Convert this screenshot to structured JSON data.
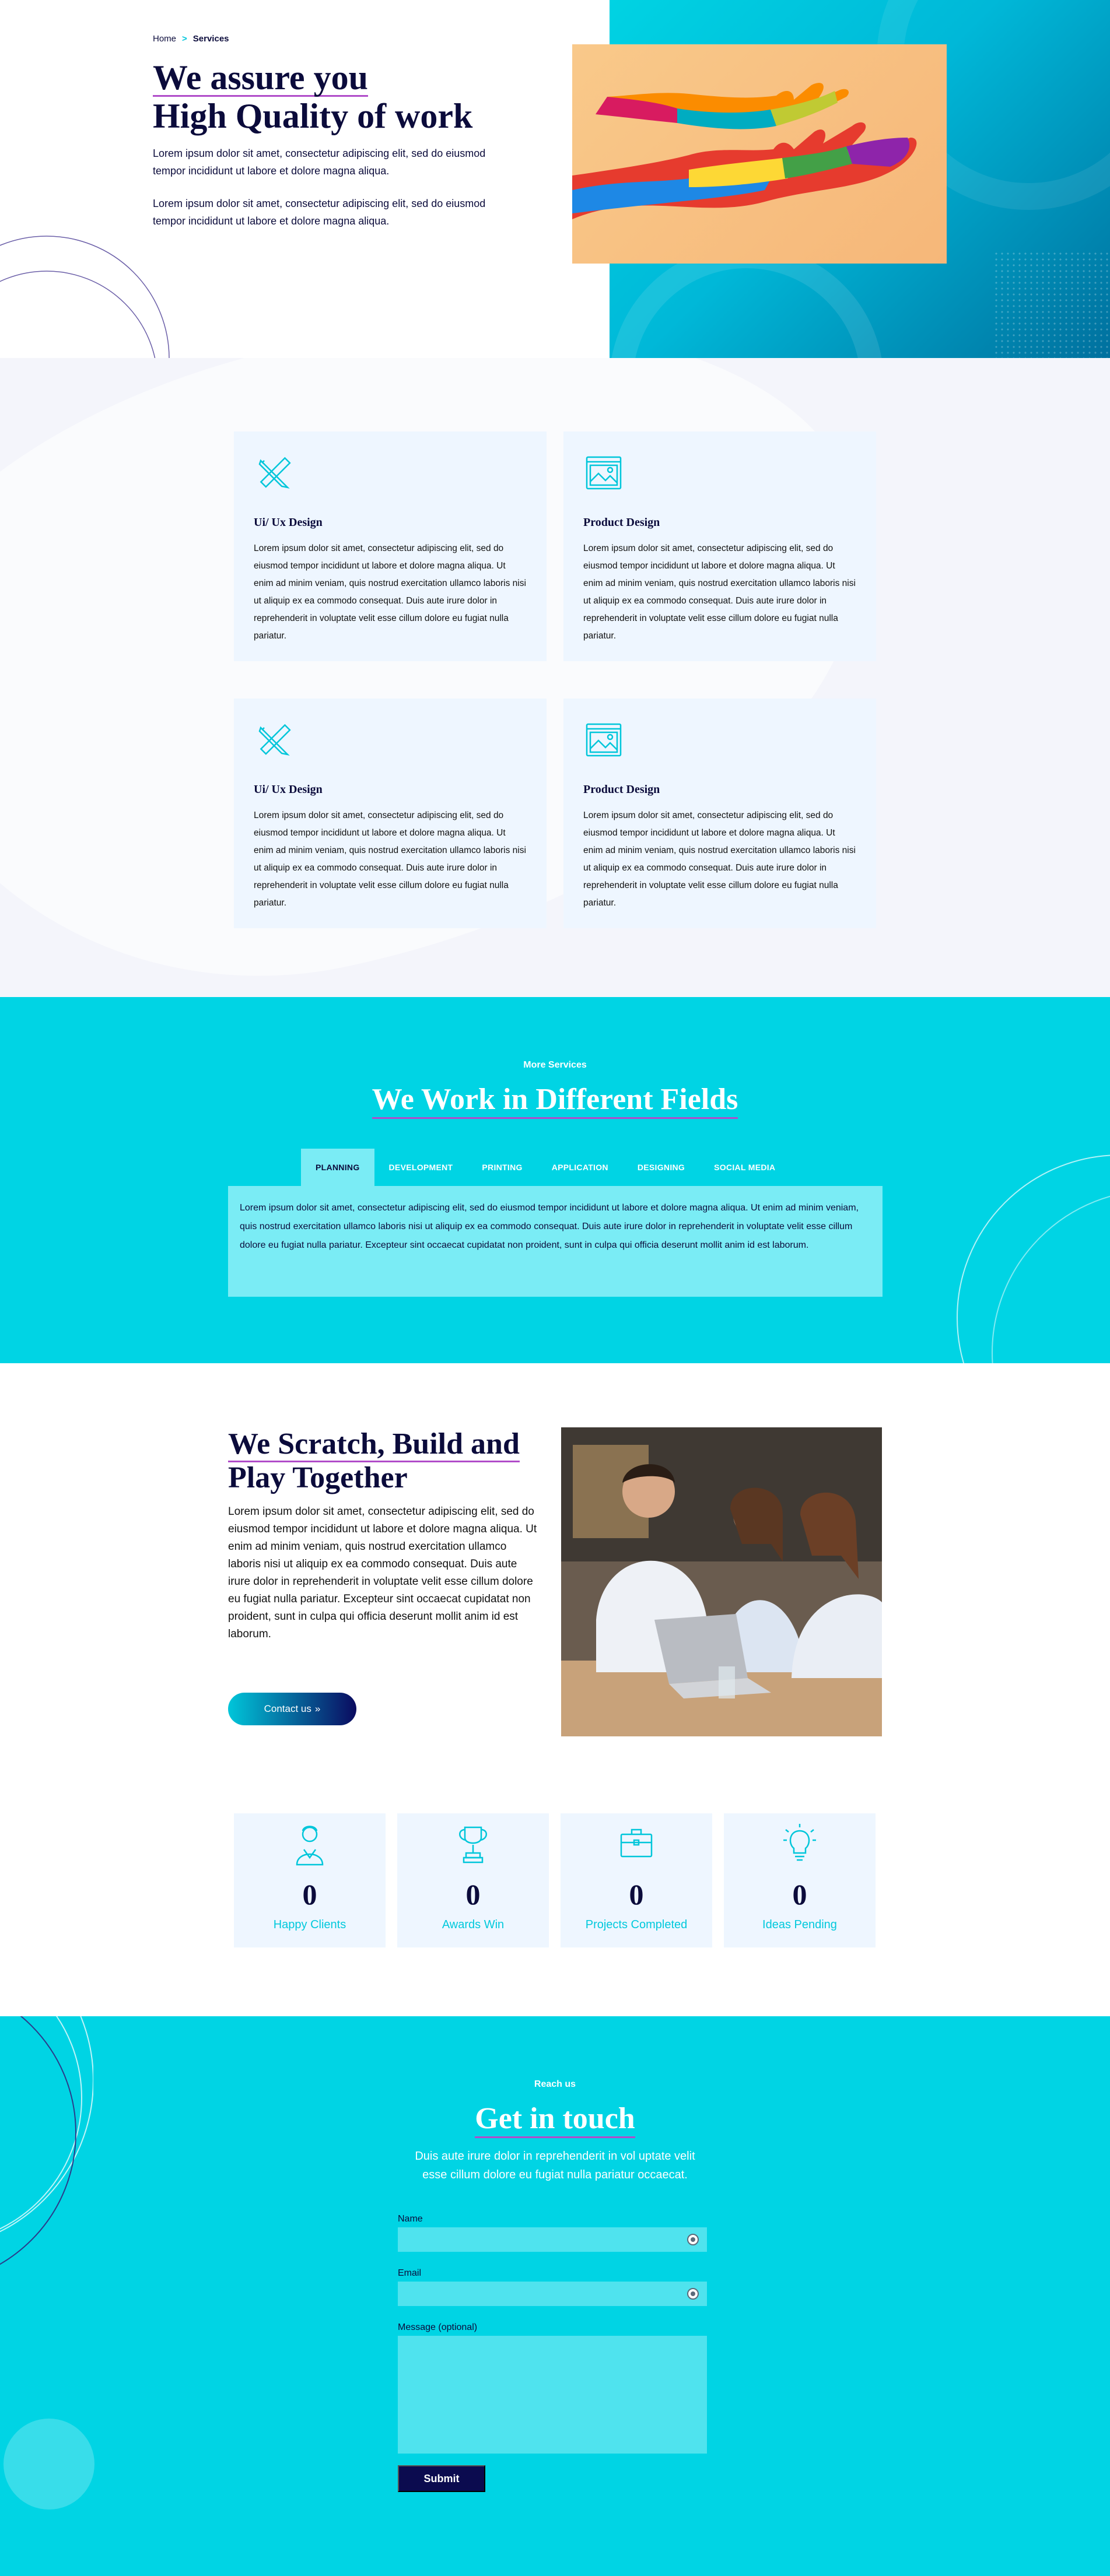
{
  "breadcrumb": {
    "home": "Home",
    "separator": ">",
    "current": "Services"
  },
  "hero": {
    "title_line1": "We assure you",
    "title_line2": "High Quality of work",
    "paragraph1": "Lorem ipsum dolor sit amet, consectetur adipiscing elit, sed do eiusmod tempor incididunt ut labore et dolore magna aliqua.",
    "paragraph2": "Lorem ipsum dolor sit amet, consectetur adipiscing elit, sed do eiusmod tempor incididunt ut labore et dolore magna aliqua."
  },
  "services": [
    {
      "title": "Ui/ Ux Design",
      "icon": "pencil-ruler-icon",
      "text": "Lorem ipsum dolor sit amet, consectetur adipiscing elit, sed do eiusmod tempor incididunt ut labore et dolore magna aliqua. Ut enim ad minim veniam, quis nostrud exercitation ullamco laboris nisi ut aliquip ex ea commodo consequat. Duis aute irure dolor in reprehenderit in voluptate velit esse cillum dolore eu fugiat nulla pariatur."
    },
    {
      "title": "Product Design",
      "icon": "image-frame-icon",
      "text": "Lorem ipsum dolor sit amet, consectetur adipiscing elit, sed do eiusmod tempor incididunt ut labore et dolore magna aliqua. Ut enim ad minim veniam, quis nostrud exercitation ullamco laboris nisi ut aliquip ex ea commodo consequat. Duis aute irure dolor in reprehenderit in voluptate velit esse cillum dolore eu fugiat nulla pariatur."
    },
    {
      "title": "Ui/ Ux Design",
      "icon": "pencil-ruler-icon",
      "text": "Lorem ipsum dolor sit amet, consectetur adipiscing elit, sed do eiusmod tempor incididunt ut labore et dolore magna aliqua. Ut enim ad minim veniam, quis nostrud exercitation ullamco laboris nisi ut aliquip ex ea commodo consequat. Duis aute irure dolor in reprehenderit in voluptate velit esse cillum dolore eu fugiat nulla pariatur."
    },
    {
      "title": "Product Design",
      "icon": "image-frame-icon",
      "text": "Lorem ipsum dolor sit amet, consectetur adipiscing elit, sed do eiusmod tempor incididunt ut labore et dolore magna aliqua. Ut enim ad minim veniam, quis nostrud exercitation ullamco laboris nisi ut aliquip ex ea commodo consequat. Duis aute irure dolor in reprehenderit in voluptate velit esse cillum dolore eu fugiat nulla pariatur."
    }
  ],
  "more_services": {
    "eyebrow": "More Services",
    "title": "We Work in Different Fields",
    "tabs": [
      "PLANNING",
      "DEVELOPMENT",
      "PRINTING",
      "APPLICATION",
      "DESIGNING",
      "SOCIAL MEDIA"
    ],
    "active_tab": "PLANNING",
    "panel_text": "Lorem ipsum dolor sit amet, consectetur adipiscing elit, sed do eiusmod tempor incididunt ut labore et dolore magna aliqua. Ut enim ad minim veniam, quis nostrud exercitation ullamco laboris nisi ut aliquip ex ea commodo consequat. Duis aute irure dolor in reprehenderit in voluptate velit esse cillum dolore eu fugiat nulla pariatur. Excepteur sint occaecat cupidatat non proident, sunt in culpa qui officia deserunt mollit anim id est laborum."
  },
  "scratch": {
    "title_line1": "We Scratch, Build and",
    "title_line2": "Play Together",
    "text": "Lorem ipsum dolor sit amet, consectetur adipiscing elit, sed do eiusmod tempor incididunt ut labore et dolore magna aliqua. Ut enim ad minim veniam, quis nostrud exercitation ullamco laboris nisi ut aliquip ex ea commodo consequat. Duis aute irure dolor in reprehenderit in voluptate velit esse cillum dolore eu fugiat nulla pariatur. Excepteur sint occaecat cupidatat non proident, sunt in culpa qui officia deserunt mollit anim id est laborum.",
    "button_label": "Contact us",
    "button_icon": "double-chevron-right-icon"
  },
  "stats": [
    {
      "value": "0",
      "label": "Happy Clients",
      "icon": "user-icon"
    },
    {
      "value": "0",
      "label": "Awards Win",
      "icon": "trophy-icon"
    },
    {
      "value": "0",
      "label": "Projects Completed",
      "icon": "briefcase-icon"
    },
    {
      "value": "0",
      "label": "Ideas Pending",
      "icon": "lightbulb-icon"
    }
  ],
  "contact": {
    "eyebrow": "Reach us",
    "title": "Get in touch",
    "subtitle_line1": "Duis aute irure dolor in reprehenderit in vol uptate velit",
    "subtitle_line2": "esse cillum dolore eu fugiat nulla pariatur occaecat.",
    "name_label": "Name",
    "name_value": "",
    "email_label": "Email",
    "email_value": "",
    "message_label": "Message (optional)",
    "message_value": "",
    "submit_label": "Submit"
  },
  "colors": {
    "navy": "#0b0b3b",
    "cyan": "#00d4e4",
    "accent_underline": "#b04cc9",
    "card_bg": "#eef6ff"
  }
}
